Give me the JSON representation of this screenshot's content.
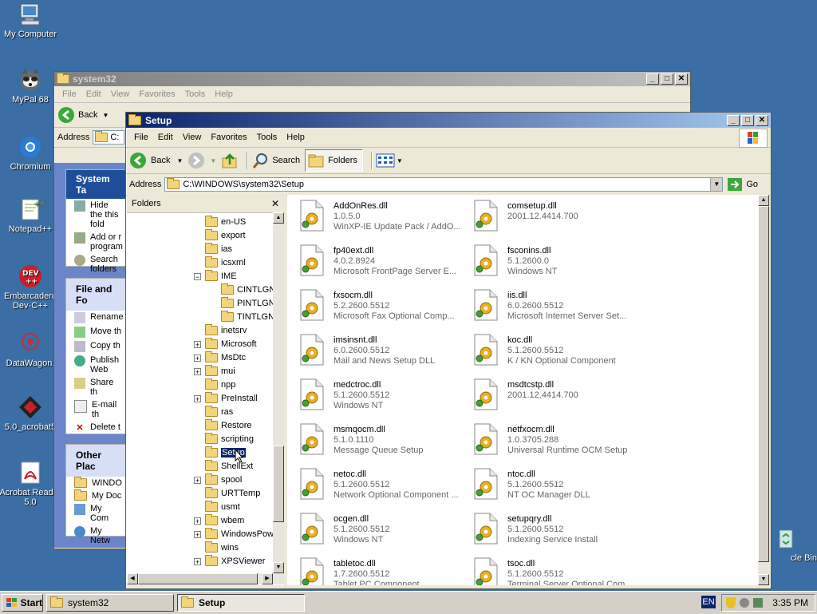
{
  "desktop_icons": [
    {
      "label": "My Computer",
      "icon": "my-computer-icon"
    },
    {
      "label": "MyPal 68",
      "icon": "raccoon-icon"
    },
    {
      "label": "Chromium",
      "icon": "chromium-icon"
    },
    {
      "label": "Notepad++",
      "icon": "notepadpp-icon"
    },
    {
      "label": "Embarcadero Dev-C++",
      "icon": "devcpp-icon"
    },
    {
      "label": "DataWagon.",
      "icon": "datawagon-icon"
    },
    {
      "label": "5.0_acrobat5",
      "icon": "acrobat-installer-icon"
    },
    {
      "label": "Acrobat Reader 5.0",
      "icon": "acrobat-reader-icon"
    },
    {
      "label": "cle Bin",
      "icon": "recycle-bin-icon"
    }
  ],
  "back_window": {
    "title": "system32",
    "menu": [
      "File",
      "Edit",
      "View",
      "Favorites",
      "Tools",
      "Help"
    ],
    "back_label": "Back",
    "address_label": "Address",
    "address_value": "C:",
    "system_tasks": {
      "heading": "System Ta",
      "items": [
        "Hide the this fold",
        "Add or r program",
        "Search folders"
      ]
    },
    "file_folder_tasks": {
      "heading": "File and Fo",
      "items": [
        "Rename",
        "Move th",
        "Copy th",
        "Publish Web",
        "Share th",
        "E-mail th",
        "Delete t"
      ]
    },
    "other_places": {
      "heading": "Other Plac",
      "items": [
        "WINDO",
        "My Doc",
        "My Com",
        "My Netw"
      ]
    }
  },
  "front_window": {
    "title": "Setup",
    "menu": [
      "File",
      "Edit",
      "View",
      "Favorites",
      "Tools",
      "Help"
    ],
    "toolbar": {
      "back": "Back",
      "search": "Search",
      "folders": "Folders"
    },
    "address_label": "Address",
    "address_value": "C:\\WINDOWS\\system32\\Setup",
    "go_label": "Go",
    "folders_pane_title": "Folders",
    "tree": [
      {
        "label": "en-US",
        "expander": ""
      },
      {
        "label": "export",
        "expander": ""
      },
      {
        "label": "ias",
        "expander": ""
      },
      {
        "label": "icsxml",
        "expander": ""
      },
      {
        "label": "IME",
        "expander": "−"
      },
      {
        "label": "CINTLGN",
        "expander": "",
        "child": true
      },
      {
        "label": "PINTLGN",
        "expander": "",
        "child": true
      },
      {
        "label": "TINTLGN",
        "expander": "",
        "child": true
      },
      {
        "label": "inetsrv",
        "expander": ""
      },
      {
        "label": "Microsoft",
        "expander": "+"
      },
      {
        "label": "MsDtc",
        "expander": "+"
      },
      {
        "label": "mui",
        "expander": "+"
      },
      {
        "label": "npp",
        "expander": ""
      },
      {
        "label": "PreInstall",
        "expander": "+"
      },
      {
        "label": "ras",
        "expander": ""
      },
      {
        "label": "Restore",
        "expander": ""
      },
      {
        "label": "scripting",
        "expander": ""
      },
      {
        "label": "Setup",
        "expander": "",
        "selected": true
      },
      {
        "label": "ShellExt",
        "expander": ""
      },
      {
        "label": "spool",
        "expander": "+"
      },
      {
        "label": "URTTemp",
        "expander": ""
      },
      {
        "label": "usmt",
        "expander": ""
      },
      {
        "label": "wbem",
        "expander": "+"
      },
      {
        "label": "WindowsPow",
        "expander": "+"
      },
      {
        "label": "wins",
        "expander": ""
      },
      {
        "label": "XPSViewer",
        "expander": "+"
      }
    ],
    "files": [
      {
        "name": "AddOnRes.dll",
        "version": "1.0.5.0",
        "desc": "WinXP-IE Update Pack / AddO..."
      },
      {
        "name": "comsetup.dll",
        "version": "2001.12.4414.700",
        "desc": ""
      },
      {
        "name": "fp40ext.dll",
        "version": "4.0.2.8924",
        "desc": "Microsoft FrontPage Server E..."
      },
      {
        "name": "fsconins.dll",
        "version": "5.1.2600.0",
        "desc": "Windows NT"
      },
      {
        "name": "fxsocm.dll",
        "version": "5.2.2600.5512",
        "desc": "Microsoft  Fax Optional Comp..."
      },
      {
        "name": "iis.dll",
        "version": "6.0.2600.5512",
        "desc": "Microsoft Internet Server Set..."
      },
      {
        "name": "imsinsnt.dll",
        "version": "6.0.2600.5512",
        "desc": "Mail and News Setup DLL"
      },
      {
        "name": "koc.dll",
        "version": "5.1.2600.5512",
        "desc": "K / KN Optional Component"
      },
      {
        "name": "medctroc.dll",
        "version": "5.1.2600.5512",
        "desc": "Windows NT"
      },
      {
        "name": "msdtcstp.dll",
        "version": "2001.12.4414.700",
        "desc": ""
      },
      {
        "name": "msmqocm.dll",
        "version": "5.1.0.1110",
        "desc": "Message Queue Setup"
      },
      {
        "name": "netfxocm.dll",
        "version": "1.0.3705.288",
        "desc": "Universal Runtime OCM Setup"
      },
      {
        "name": "netoc.dll",
        "version": "5.1.2600.5512",
        "desc": "Network Optional Component ..."
      },
      {
        "name": "ntoc.dll",
        "version": "5.1.2600.5512",
        "desc": "NT OC Manager DLL"
      },
      {
        "name": "ocgen.dll",
        "version": "5.1.2600.5512",
        "desc": "Windows NT"
      },
      {
        "name": "setupqry.dll",
        "version": "5.1.2600.5512",
        "desc": "Indexing Service Install"
      },
      {
        "name": "tabletoc.dll",
        "version": "1.7.2600.5512",
        "desc": "Tablet PC Component"
      },
      {
        "name": "tsoc.dll",
        "version": "5.1.2600.5512",
        "desc": "Terminal Server Optional Com..."
      }
    ]
  },
  "taskbar": {
    "start": "Start",
    "buttons": [
      {
        "label": "system32",
        "active": false
      },
      {
        "label": "Setup",
        "active": true
      }
    ],
    "lang": "EN",
    "clock": "3:35 PM"
  },
  "colors": {
    "desktop": "#3a6ea5",
    "title_active": "#0a246a",
    "selection": "#0a246a"
  }
}
